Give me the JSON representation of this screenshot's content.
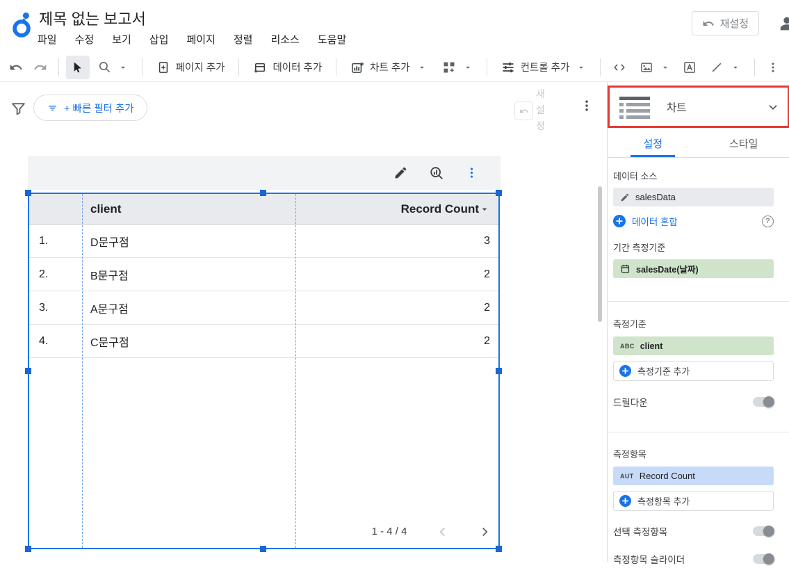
{
  "app": {
    "title": "제목 없는 보고서",
    "reset_label": "재설정"
  },
  "menus": [
    "파일",
    "수정",
    "보기",
    "삽입",
    "페이지",
    "정렬",
    "리소스",
    "도움말"
  ],
  "toolbar": {
    "add_page_label": "페이지 추가",
    "add_data_label": "데이터 추가",
    "add_chart_label": "차트 추가",
    "add_control_label": "컨트롤 추가"
  },
  "filter_bar": {
    "quick_filter_label": "+ 빠른 필터 추가",
    "ghost_lines": [
      "새",
      "설",
      "정"
    ]
  },
  "chart_selector": {
    "label": "차트"
  },
  "panel": {
    "tab_setup": "설정",
    "tab_style": "스타일",
    "data_source_label": "데이터 소스",
    "data_source_name": "salesData",
    "blend_data_label": "데이터 혼합",
    "help_glyph": "?",
    "date_dimension_label": "기간 측정기준",
    "date_dimension_value": "salesDate(날짜)",
    "dimension_label": "측정기준",
    "dimension_type": "ABC",
    "dimension_value": "client",
    "add_dimension_label": "측정기준 추가",
    "drilldown_label": "드릴다운",
    "metric_label": "측정항목",
    "metric_type": "AUT",
    "metric_value": "Record Count",
    "add_metric_label": "측정항목 추가",
    "optional_metrics_label": "선택 측정항목",
    "metric_slider_label": "측정항목 슬라이더"
  },
  "chart_data": {
    "type": "table",
    "columns": [
      "client",
      "Record Count"
    ],
    "rows": [
      {
        "num": "1.",
        "client": "D문구점",
        "record_count": 3
      },
      {
        "num": "2.",
        "client": "B문구점",
        "record_count": 2
      },
      {
        "num": "3.",
        "client": "A문구점",
        "record_count": 2
      },
      {
        "num": "4.",
        "client": "C문구점",
        "record_count": 2
      }
    ],
    "pagination": "1 - 4 / 4"
  },
  "colors": {
    "accent": "#1a73e8",
    "selection": "#1967d2",
    "red_highlight": "#e53935",
    "dimension_green": "#cfe4cb",
    "metric_blue": "#c7dbf9"
  }
}
